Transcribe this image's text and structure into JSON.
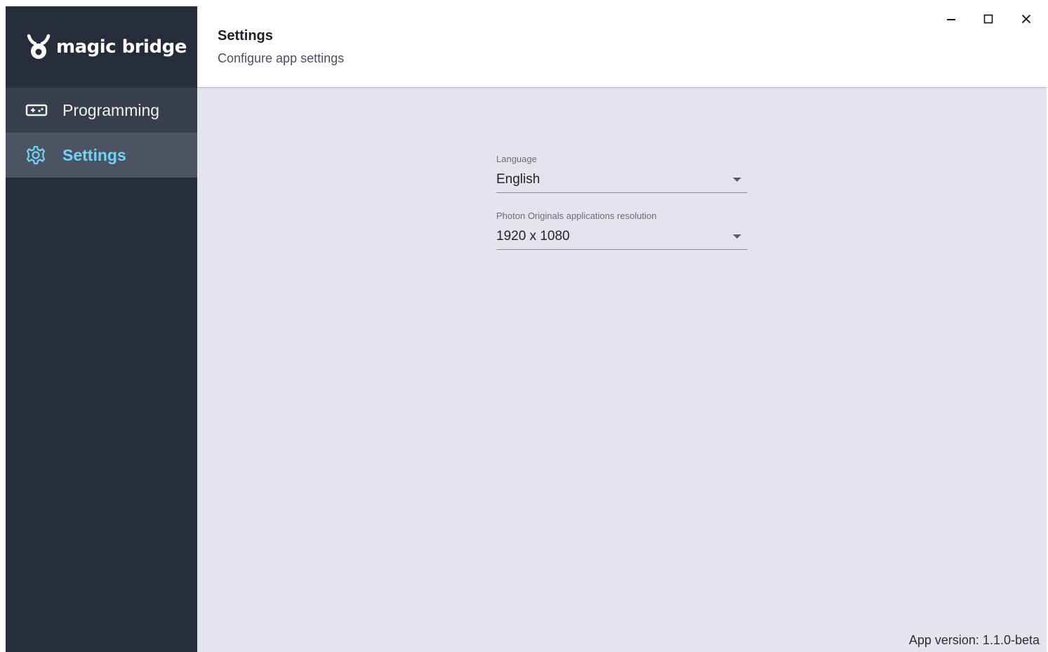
{
  "brand": {
    "name": "magic bridge",
    "logo_icon": "bull-horns-logo-icon"
  },
  "sidebar": {
    "items": [
      {
        "label": "Programming",
        "icon": "gamepad-icon",
        "active": false
      },
      {
        "label": "Settings",
        "icon": "gear-icon",
        "active": true
      }
    ]
  },
  "header": {
    "title": "Settings",
    "subtitle": "Configure app settings"
  },
  "window_controls": [
    "minimize",
    "maximize",
    "close"
  ],
  "settings": {
    "language": {
      "label": "Language",
      "value": "English"
    },
    "resolution": {
      "label": "Photon Originals applications resolution",
      "value": "1920 x 1080"
    }
  },
  "footer": {
    "version": "App version: 1.1.0-beta"
  },
  "colors": {
    "sidebar_bg": "#262c3a",
    "sidebar_active_bg": "#4c5362",
    "accent": "#72d3f6",
    "content_bg": "#e3e4ec"
  }
}
